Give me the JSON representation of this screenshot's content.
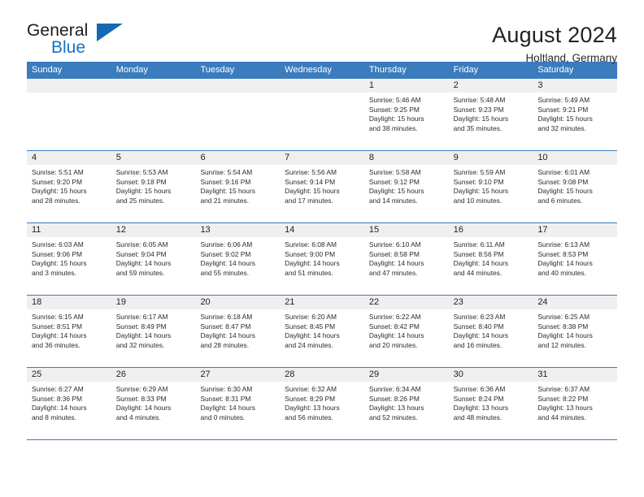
{
  "brand": {
    "word_general": "General",
    "word_blue": "Blue",
    "accent_color": "#1668b3"
  },
  "header": {
    "title": "August 2024",
    "subtitle": "Holtland, Germany"
  },
  "calendar": {
    "header_bg": "#3a7cbd",
    "daynum_bg": "#efefef",
    "weekdays": [
      "Sunday",
      "Monday",
      "Tuesday",
      "Wednesday",
      "Thursday",
      "Friday",
      "Saturday"
    ],
    "labels": {
      "sunrise": "Sunrise:",
      "sunset": "Sunset:",
      "daylight": "Daylight:"
    },
    "weeks": [
      [
        {
          "day": "",
          "empty": true
        },
        {
          "day": "",
          "empty": true
        },
        {
          "day": "",
          "empty": true
        },
        {
          "day": "",
          "empty": true
        },
        {
          "day": "1",
          "sunrise": "Sunrise: 5:46 AM",
          "sunset": "Sunset: 9:25 PM",
          "daylight_line1": "Daylight: 15 hours",
          "daylight_line2": "and 38 minutes."
        },
        {
          "day": "2",
          "sunrise": "Sunrise: 5:48 AM",
          "sunset": "Sunset: 9:23 PM",
          "daylight_line1": "Daylight: 15 hours",
          "daylight_line2": "and 35 minutes."
        },
        {
          "day": "3",
          "sunrise": "Sunrise: 5:49 AM",
          "sunset": "Sunset: 9:21 PM",
          "daylight_line1": "Daylight: 15 hours",
          "daylight_line2": "and 32 minutes."
        }
      ],
      [
        {
          "day": "4",
          "sunrise": "Sunrise: 5:51 AM",
          "sunset": "Sunset: 9:20 PM",
          "daylight_line1": "Daylight: 15 hours",
          "daylight_line2": "and 28 minutes."
        },
        {
          "day": "5",
          "sunrise": "Sunrise: 5:53 AM",
          "sunset": "Sunset: 9:18 PM",
          "daylight_line1": "Daylight: 15 hours",
          "daylight_line2": "and 25 minutes."
        },
        {
          "day": "6",
          "sunrise": "Sunrise: 5:54 AM",
          "sunset": "Sunset: 9:16 PM",
          "daylight_line1": "Daylight: 15 hours",
          "daylight_line2": "and 21 minutes."
        },
        {
          "day": "7",
          "sunrise": "Sunrise: 5:56 AM",
          "sunset": "Sunset: 9:14 PM",
          "daylight_line1": "Daylight: 15 hours",
          "daylight_line2": "and 17 minutes."
        },
        {
          "day": "8",
          "sunrise": "Sunrise: 5:58 AM",
          "sunset": "Sunset: 9:12 PM",
          "daylight_line1": "Daylight: 15 hours",
          "daylight_line2": "and 14 minutes."
        },
        {
          "day": "9",
          "sunrise": "Sunrise: 5:59 AM",
          "sunset": "Sunset: 9:10 PM",
          "daylight_line1": "Daylight: 15 hours",
          "daylight_line2": "and 10 minutes."
        },
        {
          "day": "10",
          "sunrise": "Sunrise: 6:01 AM",
          "sunset": "Sunset: 9:08 PM",
          "daylight_line1": "Daylight: 15 hours",
          "daylight_line2": "and 6 minutes."
        }
      ],
      [
        {
          "day": "11",
          "sunrise": "Sunrise: 6:03 AM",
          "sunset": "Sunset: 9:06 PM",
          "daylight_line1": "Daylight: 15 hours",
          "daylight_line2": "and 3 minutes."
        },
        {
          "day": "12",
          "sunrise": "Sunrise: 6:05 AM",
          "sunset": "Sunset: 9:04 PM",
          "daylight_line1": "Daylight: 14 hours",
          "daylight_line2": "and 59 minutes."
        },
        {
          "day": "13",
          "sunrise": "Sunrise: 6:06 AM",
          "sunset": "Sunset: 9:02 PM",
          "daylight_line1": "Daylight: 14 hours",
          "daylight_line2": "and 55 minutes."
        },
        {
          "day": "14",
          "sunrise": "Sunrise: 6:08 AM",
          "sunset": "Sunset: 9:00 PM",
          "daylight_line1": "Daylight: 14 hours",
          "daylight_line2": "and 51 minutes."
        },
        {
          "day": "15",
          "sunrise": "Sunrise: 6:10 AM",
          "sunset": "Sunset: 8:58 PM",
          "daylight_line1": "Daylight: 14 hours",
          "daylight_line2": "and 47 minutes."
        },
        {
          "day": "16",
          "sunrise": "Sunrise: 6:11 AM",
          "sunset": "Sunset: 8:56 PM",
          "daylight_line1": "Daylight: 14 hours",
          "daylight_line2": "and 44 minutes."
        },
        {
          "day": "17",
          "sunrise": "Sunrise: 6:13 AM",
          "sunset": "Sunset: 8:53 PM",
          "daylight_line1": "Daylight: 14 hours",
          "daylight_line2": "and 40 minutes."
        }
      ],
      [
        {
          "day": "18",
          "sunrise": "Sunrise: 6:15 AM",
          "sunset": "Sunset: 8:51 PM",
          "daylight_line1": "Daylight: 14 hours",
          "daylight_line2": "and 36 minutes."
        },
        {
          "day": "19",
          "sunrise": "Sunrise: 6:17 AM",
          "sunset": "Sunset: 8:49 PM",
          "daylight_line1": "Daylight: 14 hours",
          "daylight_line2": "and 32 minutes."
        },
        {
          "day": "20",
          "sunrise": "Sunrise: 6:18 AM",
          "sunset": "Sunset: 8:47 PM",
          "daylight_line1": "Daylight: 14 hours",
          "daylight_line2": "and 28 minutes."
        },
        {
          "day": "21",
          "sunrise": "Sunrise: 6:20 AM",
          "sunset": "Sunset: 8:45 PM",
          "daylight_line1": "Daylight: 14 hours",
          "daylight_line2": "and 24 minutes."
        },
        {
          "day": "22",
          "sunrise": "Sunrise: 6:22 AM",
          "sunset": "Sunset: 8:42 PM",
          "daylight_line1": "Daylight: 14 hours",
          "daylight_line2": "and 20 minutes."
        },
        {
          "day": "23",
          "sunrise": "Sunrise: 6:23 AM",
          "sunset": "Sunset: 8:40 PM",
          "daylight_line1": "Daylight: 14 hours",
          "daylight_line2": "and 16 minutes."
        },
        {
          "day": "24",
          "sunrise": "Sunrise: 6:25 AM",
          "sunset": "Sunset: 8:38 PM",
          "daylight_line1": "Daylight: 14 hours",
          "daylight_line2": "and 12 minutes."
        }
      ],
      [
        {
          "day": "25",
          "sunrise": "Sunrise: 6:27 AM",
          "sunset": "Sunset: 8:36 PM",
          "daylight_line1": "Daylight: 14 hours",
          "daylight_line2": "and 8 minutes."
        },
        {
          "day": "26",
          "sunrise": "Sunrise: 6:29 AM",
          "sunset": "Sunset: 8:33 PM",
          "daylight_line1": "Daylight: 14 hours",
          "daylight_line2": "and 4 minutes."
        },
        {
          "day": "27",
          "sunrise": "Sunrise: 6:30 AM",
          "sunset": "Sunset: 8:31 PM",
          "daylight_line1": "Daylight: 14 hours",
          "daylight_line2": "and 0 minutes."
        },
        {
          "day": "28",
          "sunrise": "Sunrise: 6:32 AM",
          "sunset": "Sunset: 8:29 PM",
          "daylight_line1": "Daylight: 13 hours",
          "daylight_line2": "and 56 minutes."
        },
        {
          "day": "29",
          "sunrise": "Sunrise: 6:34 AM",
          "sunset": "Sunset: 8:26 PM",
          "daylight_line1": "Daylight: 13 hours",
          "daylight_line2": "and 52 minutes."
        },
        {
          "day": "30",
          "sunrise": "Sunrise: 6:36 AM",
          "sunset": "Sunset: 8:24 PM",
          "daylight_line1": "Daylight: 13 hours",
          "daylight_line2": "and 48 minutes."
        },
        {
          "day": "31",
          "sunrise": "Sunrise: 6:37 AM",
          "sunset": "Sunset: 8:22 PM",
          "daylight_line1": "Daylight: 13 hours",
          "daylight_line2": "and 44 minutes."
        }
      ]
    ]
  }
}
